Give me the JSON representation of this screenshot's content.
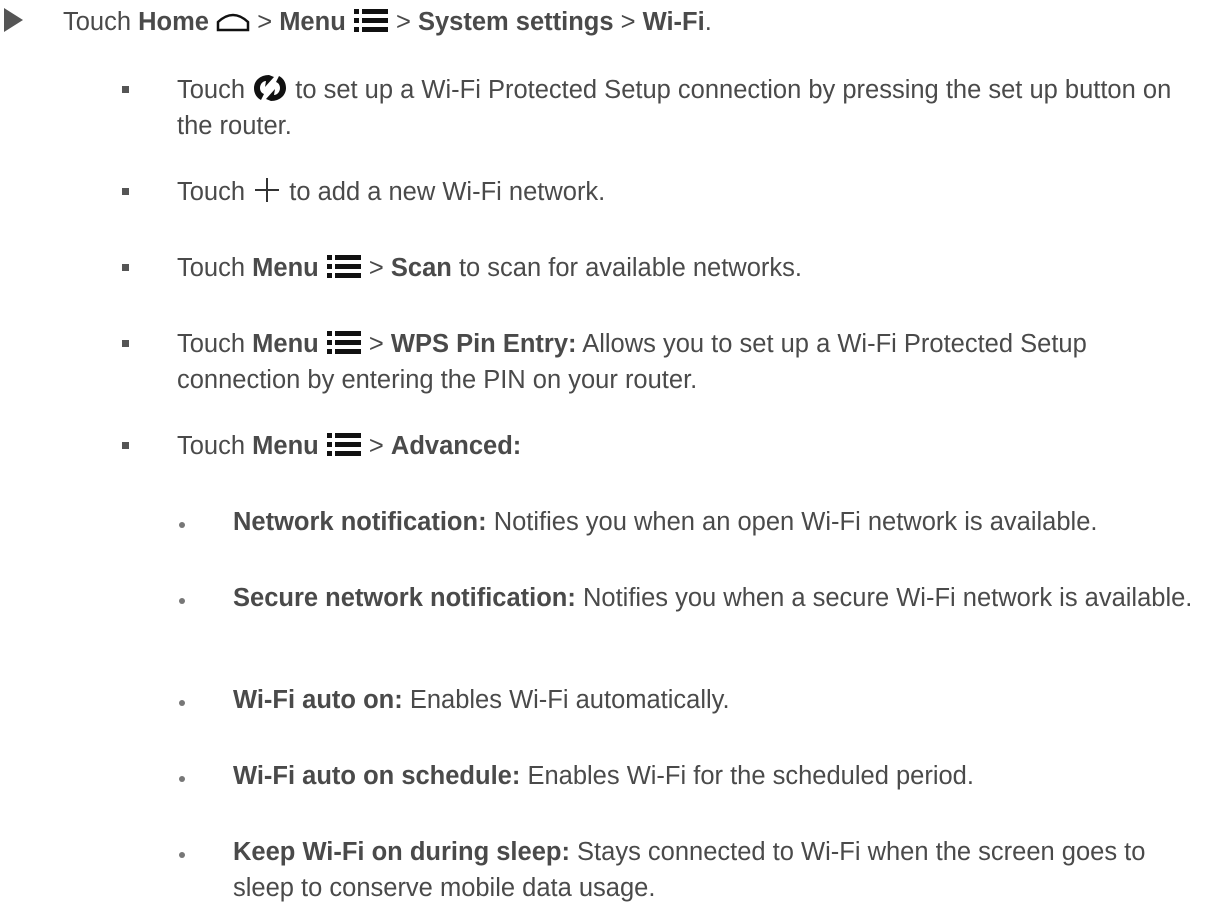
{
  "step": {
    "touch": "Touch",
    "home": "Home",
    "sep1": ">",
    "menu": "Menu",
    "sep2": ">",
    "system_settings": "System settings",
    "sep3": ">",
    "wifi": "Wi-Fi",
    "end": "."
  },
  "bullets": [
    {
      "touch": "Touch",
      "text": "to set up a Wi-Fi Protected Setup connection by pressing the set up button on the router.",
      "icon": "wps-icon"
    },
    {
      "touch": "Touch",
      "text": "to add a new Wi-Fi network.",
      "icon": "plus-icon"
    },
    {
      "touch": "Touch",
      "menu": "Menu",
      "sep": ">",
      "action": "Scan",
      "text": "to scan for available networks.",
      "icon": "menu-icon"
    },
    {
      "touch": "Touch",
      "menu": "Menu",
      "sep": ">",
      "action": "WPS Pin Entry:",
      "text": "Allows you to set up a Wi-Fi Protected Setup connection by entering the PIN on your router.",
      "icon": "menu-icon"
    },
    {
      "touch": "Touch",
      "menu": "Menu",
      "sep": ">",
      "action": "Advanced:",
      "icon": "menu-icon"
    }
  ],
  "advanced": [
    {
      "label": "Network notification:",
      "text": "Notifies you when an open Wi-Fi network is available."
    },
    {
      "label": "Secure network notification:",
      "text": "Notifies you when a secure Wi-Fi network is available."
    },
    {
      "label": "Wi-Fi auto on:",
      "text": "Enables Wi-Fi automatically."
    },
    {
      "label": "Wi-Fi auto on schedule:",
      "text": "Enables Wi-Fi for the scheduled period."
    },
    {
      "label": "Keep Wi-Fi on during sleep:",
      "text": "Stays connected to Wi-Fi when the screen goes to sleep to conserve mobile data usage."
    }
  ],
  "colors": {
    "text": "#4a4a4a",
    "icon": "#111111"
  }
}
